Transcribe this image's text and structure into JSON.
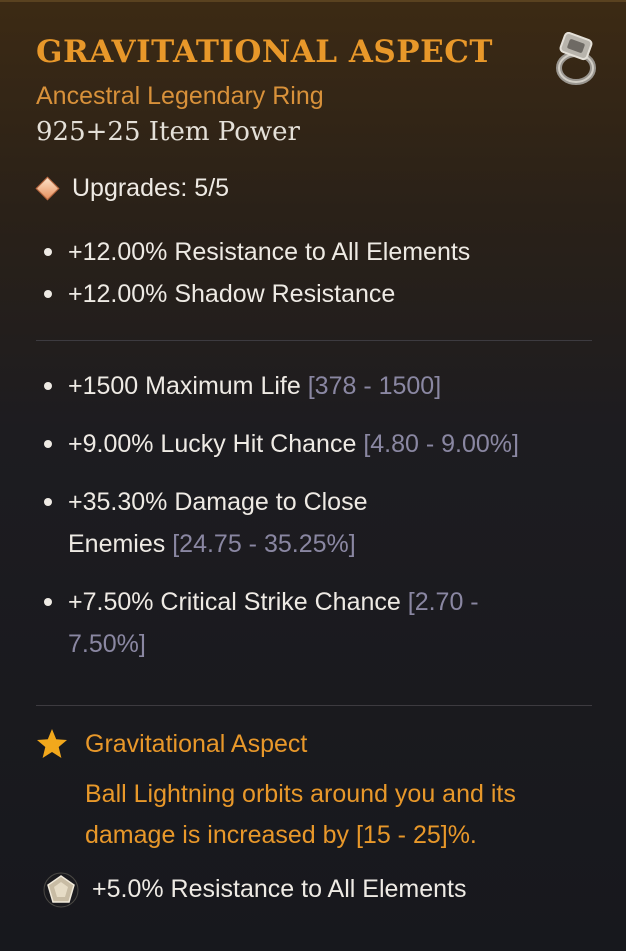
{
  "item": {
    "name": "GRAVITATIONAL ASPECT",
    "type": "Ancestral Legendary Ring",
    "item_power": "925+25 Item Power",
    "icon": "ring-icon"
  },
  "upgrades": {
    "icon": "diamond-icon",
    "label": "Upgrades: 5/5"
  },
  "implicit_stats": [
    "+12.00% Resistance to All Elements",
    "+12.00% Shadow Resistance"
  ],
  "affixes": [
    {
      "text": "+1500 Maximum Life",
      "range": "[378 - 1500]"
    },
    {
      "text": "+9.00% Lucky Hit Chance",
      "range": "[4.80 - 9.00%]"
    },
    {
      "text": "+35.30% Damage to Close Enemies",
      "range": "[24.75 - 35.25%]"
    },
    {
      "text": "+7.50% Critical Strike Chance",
      "range": "[2.70 - 7.50%]"
    }
  ],
  "aspect": {
    "icon": "star-icon",
    "name": "Gravitational Aspect",
    "description": "Ball Lightning orbits around you and its damage is increased by [15 - 25]%."
  },
  "socket": {
    "icon": "gem-icon",
    "text": "+5.0% Resistance to All Elements"
  },
  "colors": {
    "title": "#e8982a",
    "legendary": "#d8913a",
    "text": "#eeeae4",
    "range": "#8a87a2",
    "divider": "#3d3b40"
  }
}
